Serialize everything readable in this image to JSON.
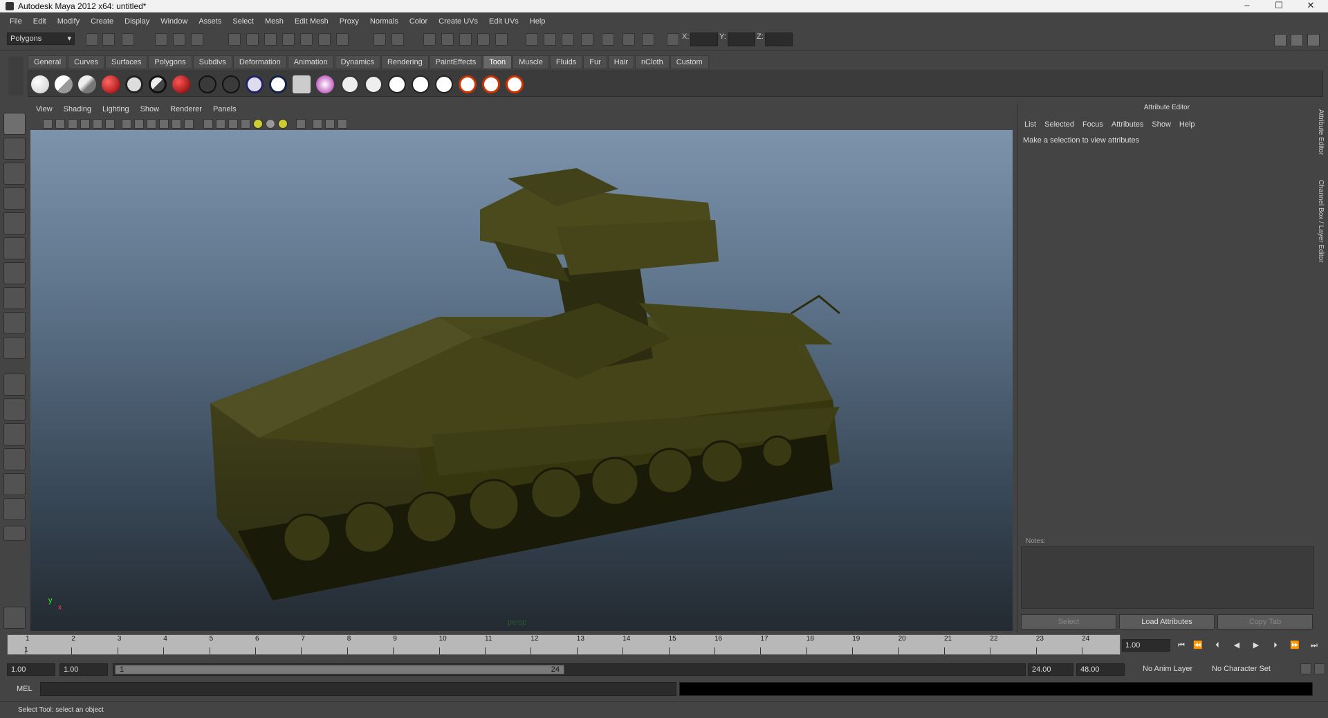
{
  "window": {
    "title": "Autodesk Maya 2012 x64: untitled*",
    "minimize": "–",
    "maximize": "☐",
    "close": "✕"
  },
  "menubar": [
    "File",
    "Edit",
    "Modify",
    "Create",
    "Display",
    "Window",
    "Assets",
    "Select",
    "Mesh",
    "Edit Mesh",
    "Proxy",
    "Normals",
    "Color",
    "Create UVs",
    "Edit UVs",
    "Help"
  ],
  "statusline": {
    "mode": "Polygons",
    "x_label": "X:",
    "y_label": "Y:",
    "z_label": "Z:"
  },
  "shelf": {
    "tabs": [
      "General",
      "Curves",
      "Surfaces",
      "Polygons",
      "Subdivs",
      "Deformation",
      "Animation",
      "Dynamics",
      "Rendering",
      "PaintEffects",
      "Toon",
      "Muscle",
      "Fluids",
      "Fur",
      "Hair",
      "nCloth",
      "Custom"
    ],
    "active_tab": "Toon"
  },
  "viewport": {
    "menu": [
      "View",
      "Shading",
      "Lighting",
      "Show",
      "Renderer",
      "Panels"
    ],
    "camera": "persp",
    "axis_y": "y",
    "axis_x": "x"
  },
  "attribute_editor": {
    "title": "Attribute Editor",
    "menu": [
      "List",
      "Selected",
      "Focus",
      "Attributes",
      "Show",
      "Help"
    ],
    "message": "Make a selection to view attributes",
    "notes_label": "Notes:",
    "buttons": {
      "select": "Select",
      "load": "Load Attributes",
      "copy": "Copy Tab"
    }
  },
  "side_tabs": {
    "attr": "Attribute Editor",
    "channel": "Channel Box / Layer Editor"
  },
  "timeline": {
    "ticks": [
      "1",
      "2",
      "3",
      "4",
      "5",
      "6",
      "7",
      "8",
      "9",
      "10",
      "11",
      "12",
      "13",
      "14",
      "15",
      "16",
      "17",
      "18",
      "19",
      "20",
      "21",
      "22",
      "23",
      "24"
    ],
    "current_time": "1.00",
    "start_marker": "1"
  },
  "range": {
    "start": "1.00",
    "playback_start": "1.00",
    "handle_start": "1",
    "handle_end": "24",
    "playback_end": "24.00",
    "end": "48.00",
    "anim_layer": "No Anim Layer",
    "char_set": "No Character Set"
  },
  "command": {
    "label": "MEL"
  },
  "help_line": "Select Tool: select an object"
}
